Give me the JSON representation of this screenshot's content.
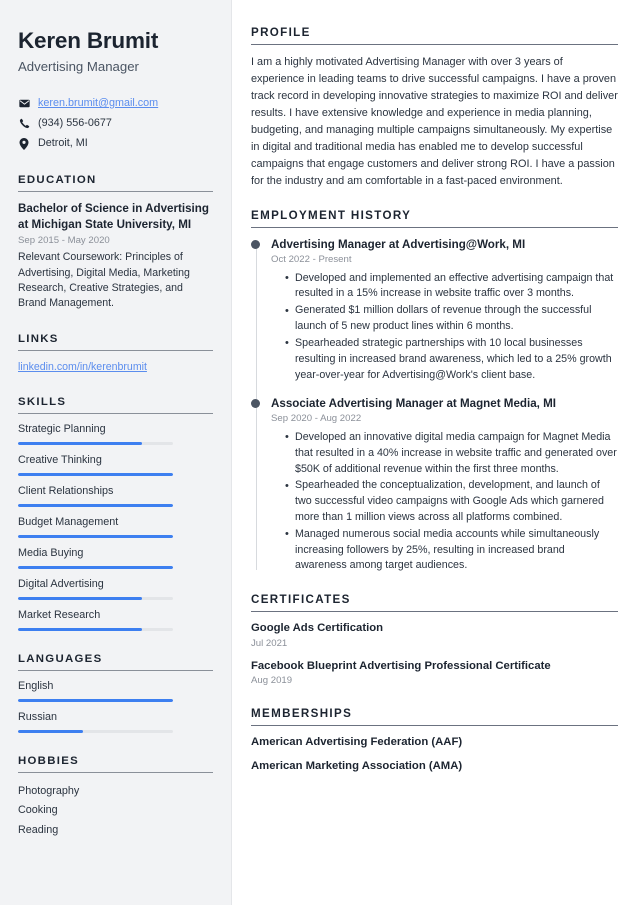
{
  "theme": {
    "accent": "#3d7ff0",
    "sidebar_bg": "#f2f3f5",
    "heading": "#1c2430",
    "muted": "#8b9099",
    "link": "#5b8dee"
  },
  "sidebar": {
    "name": "Keren Brumit",
    "job_title": "Advertising Manager",
    "contacts": [
      {
        "icon": "envelope-icon",
        "text": "keren.brumit@gmail.com",
        "is_link": true
      },
      {
        "icon": "phone-icon",
        "text": "(934) 556-0677",
        "is_link": false
      },
      {
        "icon": "location-pin-icon",
        "text": "Detroit, MI",
        "is_link": false
      }
    ],
    "education": {
      "heading": "EDUCATION",
      "degree": "Bachelor of Science in Advertising at Michigan State University, MI",
      "date": "Sep 2015 - May 2020",
      "description": "Relevant Coursework: Principles of Advertising, Digital Media, Marketing Research, Creative Strategies, and Brand Management."
    },
    "links": {
      "heading": "LINKS",
      "items": [
        {
          "label": "linkedin.com/in/kerenbrumit"
        }
      ]
    },
    "skills": {
      "heading": "SKILLS",
      "items": [
        {
          "label": "Strategic Planning",
          "level": 80
        },
        {
          "label": "Creative Thinking",
          "level": 100
        },
        {
          "label": "Client Relationships",
          "level": 100
        },
        {
          "label": "Budget Management",
          "level": 100
        },
        {
          "label": "Media Buying",
          "level": 100
        },
        {
          "label": "Digital Advertising",
          "level": 80
        },
        {
          "label": "Market Research",
          "level": 80
        }
      ]
    },
    "languages": {
      "heading": "LANGUAGES",
      "items": [
        {
          "label": "English",
          "level": 100
        },
        {
          "label": "Russian",
          "level": 42
        }
      ]
    },
    "hobbies": {
      "heading": "HOBBIES",
      "items": [
        {
          "label": "Photography"
        },
        {
          "label": "Cooking"
        },
        {
          "label": "Reading"
        }
      ]
    }
  },
  "main": {
    "profile": {
      "heading": "PROFILE",
      "text": "I am a highly motivated Advertising Manager with over 3 years of experience in leading teams to drive successful campaigns. I have a proven track record in developing innovative strategies to maximize ROI and deliver results. I have extensive knowledge and experience in media planning, budgeting, and managing multiple campaigns simultaneously. My expertise in digital and traditional media has enabled me to develop successful campaigns that engage customers and deliver strong ROI. I have a passion for the industry and am comfortable in a fast-paced environment."
    },
    "employment": {
      "heading": "EMPLOYMENT HISTORY",
      "jobs": [
        {
          "role": "Advertising Manager at Advertising@Work, MI",
          "date": "Oct 2022 - Present",
          "bullets": [
            "Developed and implemented an effective advertising campaign that resulted in a 15% increase in website traffic over 3 months.",
            "Generated $1 million dollars of revenue through the successful launch of 5 new product lines within 6 months.",
            "Spearheaded strategic partnerships with 10 local businesses resulting in increased brand awareness, which led to a 25% growth year-over-year for Advertising@Work's client base."
          ]
        },
        {
          "role": "Associate Advertising Manager at Magnet Media, MI",
          "date": "Sep 2020 - Aug 2022",
          "bullets": [
            "Developed an innovative digital media campaign for Magnet Media that resulted in a 40% increase in website traffic and generated over $50K of additional revenue within the first three months.",
            "Spearheaded the conceptualization, development, and launch of two successful video campaigns with Google Ads which garnered more than 1 million views across all platforms combined.",
            "Managed numerous social media accounts while simultaneously increasing followers by 25%, resulting in increased brand awareness among target audiences."
          ]
        }
      ]
    },
    "certificates": {
      "heading": "CERTIFICATES",
      "items": [
        {
          "title": "Google Ads Certification",
          "date": "Jul 2021"
        },
        {
          "title": "Facebook Blueprint Advertising Professional Certificate",
          "date": "Aug 2019"
        }
      ]
    },
    "memberships": {
      "heading": "MEMBERSHIPS",
      "items": [
        {
          "label": "American Advertising Federation (AAF)"
        },
        {
          "label": "American Marketing Association (AMA)"
        }
      ]
    }
  }
}
